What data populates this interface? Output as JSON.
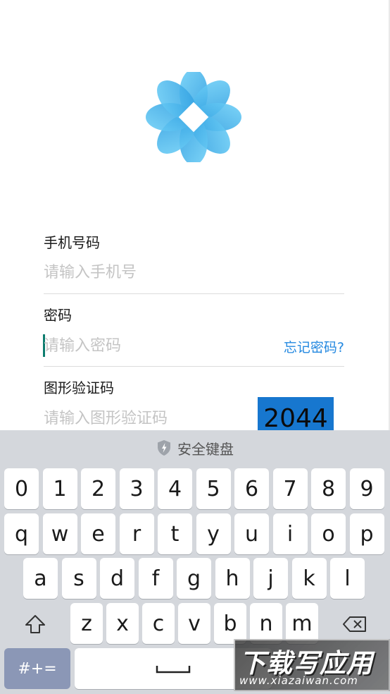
{
  "form": {
    "phone": {
      "label": "手机号码",
      "placeholder": "请输入手机号",
      "value": ""
    },
    "password": {
      "label": "密码",
      "placeholder": "请输入密码",
      "value": "",
      "forgot_link": "忘记密码?"
    },
    "captcha": {
      "label": "图形验证码",
      "placeholder": "请输入图形验证码",
      "value": "",
      "image_text": "2044"
    }
  },
  "keyboard": {
    "title": "安全键盘",
    "title_icon": "shield-icon",
    "rows": [
      [
        "0",
        "1",
        "2",
        "3",
        "4",
        "5",
        "6",
        "7",
        "8",
        "9"
      ],
      [
        "q",
        "w",
        "e",
        "r",
        "t",
        "y",
        "u",
        "i",
        "o",
        "p"
      ],
      [
        "a",
        "s",
        "d",
        "f",
        "g",
        "h",
        "j",
        "k",
        "l"
      ],
      [
        "z",
        "x",
        "c",
        "v",
        "b",
        "n",
        "m"
      ]
    ],
    "shift_icon": "shift-arrow-icon",
    "backspace_icon": "backspace-icon",
    "symbols_label": "#+=",
    "space_icon": "space-bar-icon"
  },
  "colors": {
    "accent": "#2388e0",
    "captcha_bg": "#1777cf",
    "cursor": "#0e7d6f",
    "keyboard_bg": "#d4d7dc",
    "symbols_key": "#8b97b6",
    "logo": "#3fb4ec"
  },
  "watermark": {
    "title": "下载写应用",
    "url": "www.xiazaiwan.com"
  }
}
